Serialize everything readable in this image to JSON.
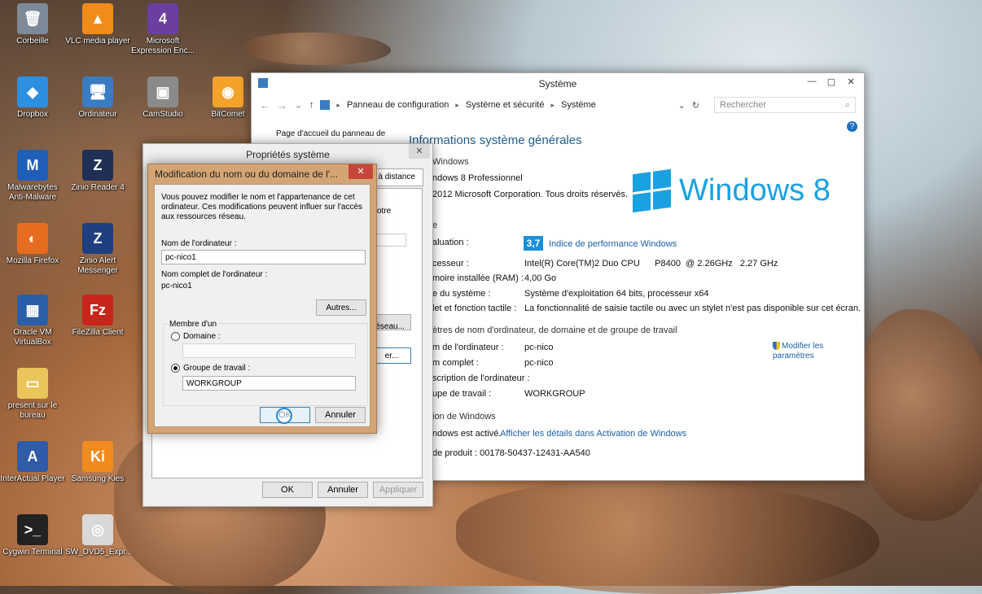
{
  "desktop": {
    "icons": [
      {
        "label": "Corbeille",
        "icon": "trash-icon",
        "color": "#7d8a99",
        "glyph": "🗑"
      },
      {
        "label": "VLC media player",
        "icon": "vlc-icon",
        "color": "#f08c1a",
        "glyph": "▲"
      },
      {
        "label": "Microsoft Expression Enc...",
        "icon": "expression-icon",
        "color": "#6a3fa0",
        "glyph": "4"
      },
      {
        "label": "Dropbox",
        "icon": "dropbox-icon",
        "color": "#2c8fe0",
        "glyph": "◆"
      },
      {
        "label": "Ordinateur",
        "icon": "computer-icon",
        "color": "#3a7cc1",
        "glyph": "🖥"
      },
      {
        "label": "CamStudio",
        "icon": "camstudio-icon",
        "color": "#8a8a8a",
        "glyph": "▣"
      },
      {
        "label": "BitComet",
        "icon": "bitcomet-icon",
        "color": "#f3a22a",
        "glyph": "◉"
      },
      {
        "label": "Malwarebytes Anti-Malware",
        "icon": "malwarebytes-icon",
        "color": "#1f5fb8",
        "glyph": "M"
      },
      {
        "label": "Zinio Reader 4",
        "icon": "zinio-reader-icon",
        "color": "#1f2f55",
        "glyph": "Z"
      },
      {
        "label": "Mozilla Firefox",
        "icon": "firefox-icon",
        "color": "#e66d1f",
        "glyph": "◐"
      },
      {
        "label": "Zinio Alert Messenger",
        "icon": "zinio-alert-icon",
        "color": "#1f3f80",
        "glyph": "Z"
      },
      {
        "label": "Oracle VM VirtualBox",
        "icon": "virtualbox-icon",
        "color": "#2a5fa8",
        "glyph": "▦"
      },
      {
        "label": "FileZilla Client",
        "icon": "filezilla-icon",
        "color": "#c8261c",
        "glyph": "Fz"
      },
      {
        "label": "present sur le bureau",
        "icon": "folder-icon",
        "color": "#e9c55b",
        "glyph": "▭"
      },
      {
        "label": "InterActual Player",
        "icon": "interactual-icon",
        "color": "#2f5ba8",
        "glyph": "A"
      },
      {
        "label": "Samsung Kies",
        "icon": "kies-icon",
        "color": "#f18b1e",
        "glyph": "Ki"
      },
      {
        "label": "Cygwin Terminal",
        "icon": "cygwin-icon",
        "color": "#222222",
        "glyph": ">_"
      },
      {
        "label": "SW_DVD5_Expr...",
        "icon": "disc-icon",
        "color": "#d8d8d8",
        "glyph": "◎"
      }
    ]
  },
  "system_window": {
    "title": "Système",
    "breadcrumb": [
      "Panneau de configuration",
      "Système et sécurité",
      "Système"
    ],
    "search_placeholder": "Rechercher",
    "left_link": "Page d'accueil du panneau de configuration",
    "heading": "Informations système générales",
    "edition_section": "Windows",
    "edition": "ndows 8 Professionnel",
    "copyright": "2012 Microsoft Corporation. Tous droits réservés.",
    "logo_text": "Windows 8",
    "system_section": "e",
    "rating_label": "aluation :",
    "rating_value": "3,7",
    "rating_link": "Indice de performance Windows",
    "processor_label": "cesseur :",
    "processor_value": "Intel(R) Core(TM)2 Duo CPU      P8400  @ 2.26GHz   2.27 GHz",
    "ram_label": "moire installée (RAM) :",
    "ram_value": "4,00 Go",
    "type_label": "e du système :",
    "type_value": "Système d'exploitation 64 bits, processeur x64",
    "pen_label": "let et fonction tactile :",
    "pen_value": "La fonctionnalité de saisie tactile ou avec un stylet n'est pas disponible sur cet écran.",
    "name_section": "ètres de nom d'ordinateur, de domaine et de groupe de travail",
    "computer_name_label": "m de l'ordinateur :",
    "computer_name_value": "pc-nico",
    "full_name_label": "m complet :",
    "full_name_value": "pc-nico",
    "description_label": "scription de l'ordinateur :",
    "workgroup_label": "upe de travail :",
    "workgroup_value": "WORKGROUP",
    "modify_link": "Modifier les paramètres",
    "activation_section": "ion de Windows",
    "activation_status": "ndows est activé.",
    "activation_link": "Afficher les détails dans Activation de Windows",
    "product_id": "de produit : 00178-50437-12431-AA540"
  },
  "properties_window": {
    "title": "Propriétés système",
    "tab_remote": "n à distance",
    "partial_text_votre": "votre",
    "partial_btn_network": "e réseau...",
    "partial_btn_change": "er...",
    "ok": "OK",
    "cancel": "Annuler",
    "apply": "Appliquer"
  },
  "modify_dialog": {
    "title": "Modification du nom ou du domaine de l'...",
    "description": "Vous pouvez modifier le nom et l'appartenance de cet ordinateur. Ces modifications peuvent influer sur l'accès aux ressources réseau.",
    "computer_name_label": "Nom de l'ordinateur :",
    "computer_name_value": "pc-nico1",
    "full_name_label": "Nom complet de l'ordinateur :",
    "full_name_value": "pc-nico1",
    "more_button": "Autres...",
    "member_of_label": "Membre d'un",
    "domain_label": "Domaine :",
    "domain_value": "",
    "workgroup_label": "Groupe de travail :",
    "workgroup_value": "WORKGROUP",
    "ok": "OK",
    "cancel": "Annuler"
  }
}
